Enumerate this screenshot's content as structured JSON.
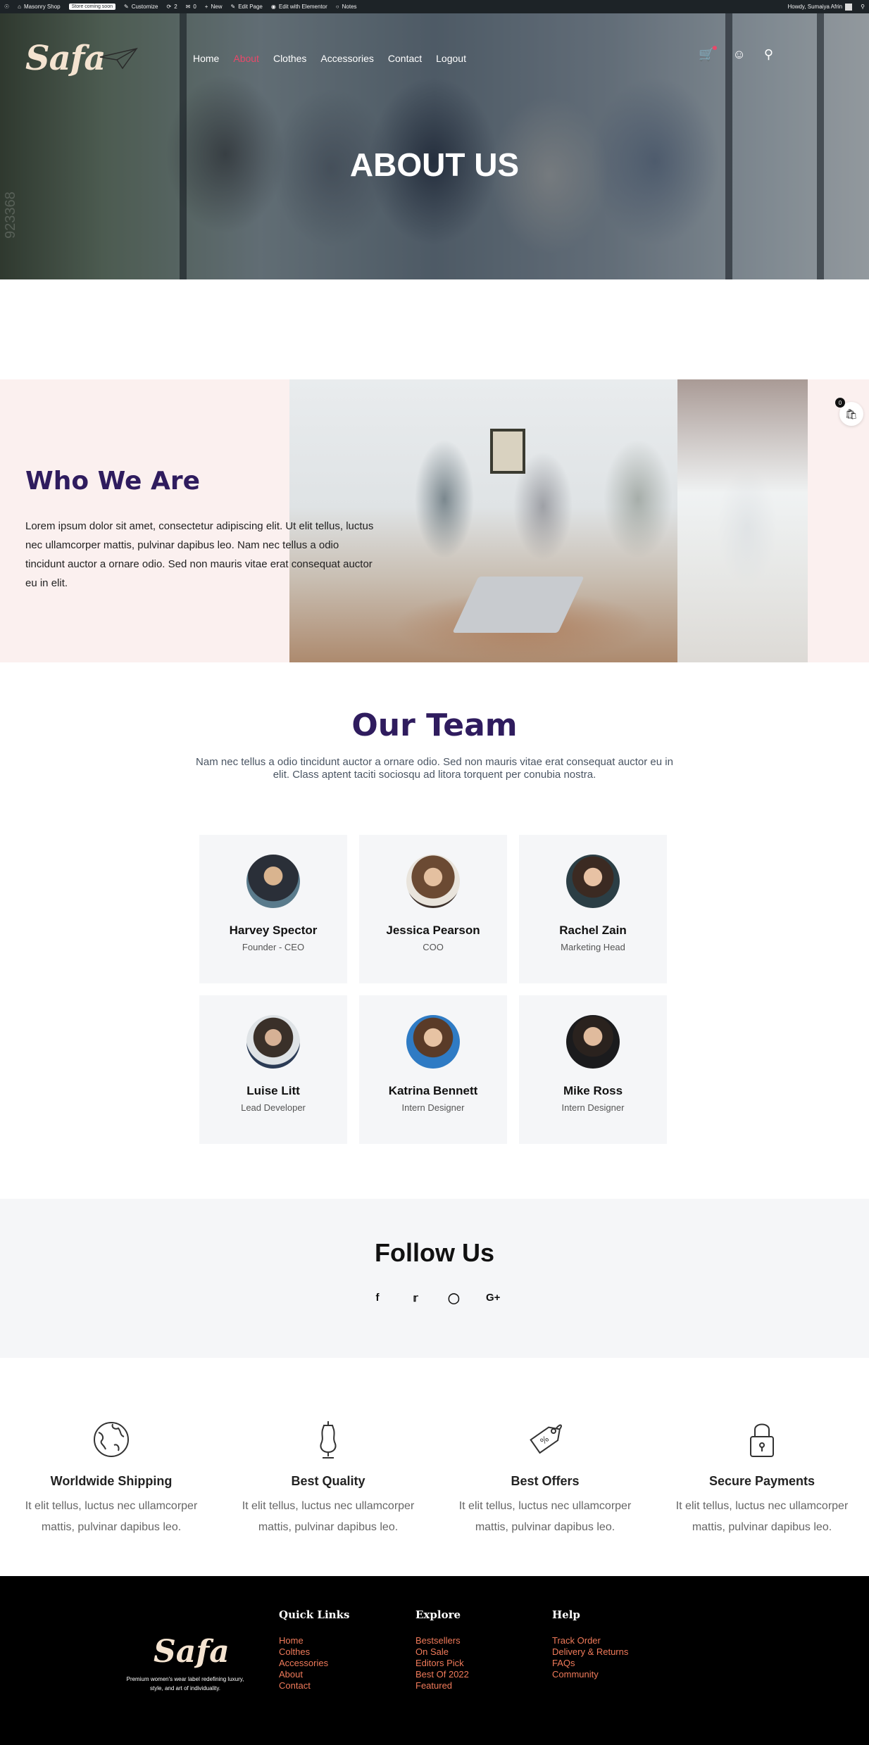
{
  "admin_bar": {
    "site_name": "Masonry Shop",
    "store_badge": "Store coming soon",
    "customize": "Customize",
    "updates_count": "2",
    "comments_count": "0",
    "new": "New",
    "edit_page": "Edit Page",
    "edit_elementor": "Edit with Elementor",
    "notes": "Notes",
    "howdy": "Howdy, Sumaiya Afrin"
  },
  "header": {
    "logo": "Safa",
    "nav": [
      "Home",
      "About",
      "Clothes",
      "Accessories",
      "Contact",
      "Logout"
    ],
    "active_nav": "About"
  },
  "hero": {
    "title": "ABOUT US",
    "watermark": "923368"
  },
  "who_we_are": {
    "title": "Who We Are",
    "body": "Lorem ipsum dolor sit amet, consectetur adipiscing elit. Ut elit tellus, luctus nec ullamcorper mattis, pulvinar dapibus leo. Nam nec tellus a odio tincidunt auctor a ornare odio. Sed non mauris vitae erat consequat auctor eu in elit.",
    "cart_count": "0"
  },
  "team": {
    "title": "Our Team",
    "subtitle": "Nam nec tellus a odio tincidunt auctor a ornare odio. Sed non mauris vitae erat consequat auctor eu in elit. Class aptent taciti sociosqu ad litora torquent per conubia nostra.",
    "members": [
      {
        "name": "Harvey Spector",
        "role": "Founder - CEO"
      },
      {
        "name": "Jessica Pearson",
        "role": "COO"
      },
      {
        "name": "Rachel Zain",
        "role": "Marketing Head"
      },
      {
        "name": "Luise Litt",
        "role": "Lead Developer"
      },
      {
        "name": "Katrina Bennett",
        "role": "Intern Designer"
      },
      {
        "name": "Mike Ross",
        "role": "Intern Designer"
      }
    ]
  },
  "follow": {
    "title": "Follow Us",
    "icons": [
      "facebook-icon",
      "twitter-icon",
      "instagram-icon",
      "google-plus-icon"
    ]
  },
  "features": [
    {
      "title": "Worldwide Shipping",
      "body": "It elit tellus, luctus nec ullamcorper mattis, pulvinar dapibus leo.",
      "icon": "globe-icon"
    },
    {
      "title": "Best Quality",
      "body": "It elit tellus, luctus nec ullamcorper mattis, pulvinar dapibus leo.",
      "icon": "dress-form-icon"
    },
    {
      "title": "Best Offers",
      "body": "It elit tellus, luctus nec ullamcorper mattis, pulvinar dapibus leo.",
      "icon": "price-tag-icon"
    },
    {
      "title": "Secure Payments",
      "body": "It elit tellus, luctus nec ullamcorper mattis, pulvinar dapibus leo.",
      "icon": "padlock-icon"
    }
  ],
  "footer": {
    "logo": "Safa",
    "tagline": "Premium women's wear label redefining luxury, style, and art of individuality.",
    "columns": [
      {
        "heading": "Quick Links",
        "links": [
          "Home",
          "Colthes",
          "Accessories",
          "About",
          "Contact"
        ]
      },
      {
        "heading": "Explore",
        "links": [
          "Bestsellers",
          "On Sale",
          "Editors Pick",
          "Best Of 2022",
          "Featured"
        ]
      },
      {
        "heading": "Help",
        "links": [
          "Track Order",
          "Delivery & Returns",
          "FAQs",
          "Community"
        ]
      }
    ]
  },
  "colors": {
    "accent_pink": "#e8496a",
    "heading_purple": "#2f1c5e",
    "footer_link": "#f07a5a",
    "who_bg": "#fbf0ef",
    "card_bg": "#f5f6f8"
  }
}
